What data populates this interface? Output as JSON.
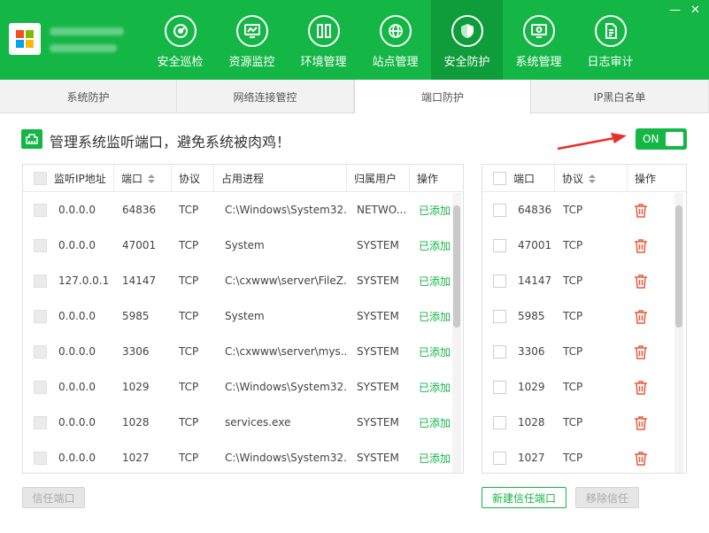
{
  "nav": [
    "安全巡检",
    "资源监控",
    "环境管理",
    "站点管理",
    "安全防护",
    "系统管理",
    "日志审计"
  ],
  "nav_icons": [
    "radar-icon",
    "monitor-chart-icon",
    "server-rack-icon",
    "globe-icon",
    "shield-icon",
    "monitor-gear-icon",
    "document-icon"
  ],
  "window": {
    "minimize": "—",
    "close": "✕"
  },
  "subtabs": [
    "系统防护",
    "网络连接管控",
    "端口防护",
    "IP黑白名单"
  ],
  "banner": {
    "text": "管理系统监听端口，避免系统被肉鸡！",
    "toggle": "ON"
  },
  "left_table": {
    "headers": [
      "监听IP地址",
      "端口",
      "协议",
      "占用进程",
      "归属用户",
      "操作"
    ],
    "rows": [
      [
        "0.0.0.0",
        "64836",
        "TCP",
        "C:\\Windows\\System32...",
        "NETWO...",
        "已添加"
      ],
      [
        "0.0.0.0",
        "47001",
        "TCP",
        "System",
        "SYSTEM",
        "已添加"
      ],
      [
        "127.0.0.1",
        "14147",
        "TCP",
        "C:\\cxwww\\server\\FileZ...",
        "SYSTEM",
        "已添加"
      ],
      [
        "0.0.0.0",
        "5985",
        "TCP",
        "System",
        "SYSTEM",
        "已添加"
      ],
      [
        "0.0.0.0",
        "3306",
        "TCP",
        "C:\\cxwww\\server\\mys...",
        "SYSTEM",
        "已添加"
      ],
      [
        "0.0.0.0",
        "1029",
        "TCP",
        "C:\\Windows\\System32...",
        "SYSTEM",
        "已添加"
      ],
      [
        "0.0.0.0",
        "1028",
        "TCP",
        "services.exe",
        "SYSTEM",
        "已添加"
      ],
      [
        "0.0.0.0",
        "1027",
        "TCP",
        "C:\\Windows\\System32...",
        "SYSTEM",
        "已添加"
      ]
    ]
  },
  "right_table": {
    "headers": [
      "端口",
      "协议",
      "操作"
    ],
    "rows": [
      [
        "64836",
        "TCP"
      ],
      [
        "47001",
        "TCP"
      ],
      [
        "14147",
        "TCP"
      ],
      [
        "5985",
        "TCP"
      ],
      [
        "3306",
        "TCP"
      ],
      [
        "1029",
        "TCP"
      ],
      [
        "1028",
        "TCP"
      ],
      [
        "1027",
        "TCP"
      ]
    ]
  },
  "buttons": {
    "trust_port": "信任端口",
    "new_trust_port": "新建信任端口",
    "remove_trust": "移除信任"
  },
  "colors": {
    "accent": "#14b646",
    "delete": "#e85a3a",
    "arrow": "#e8302a"
  }
}
